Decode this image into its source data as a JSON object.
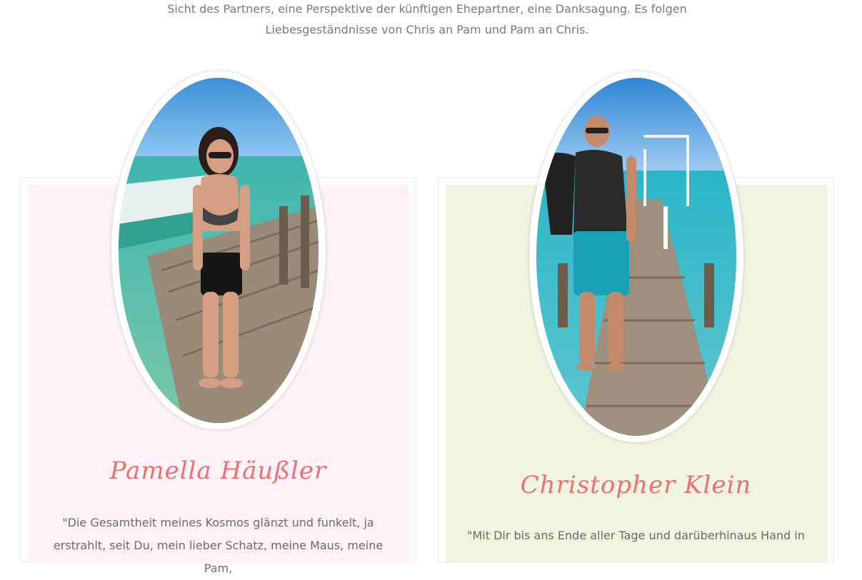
{
  "intro": {
    "line1": "Sicht des Partners, eine Perspektive der künftigen Ehepartner, eine Danksagung. Es folgen",
    "line2": "Liebesgeständnisse von Chris an Pam und Pam an Chris."
  },
  "profiles": [
    {
      "name": "Pamella Häußler",
      "quote": "\"Die Gesamtheit meines Kosmos glänzt und funkelt, ja erstrahlt, seit Du, mein lieber Schatz, meine Maus, meine Pam,",
      "card_color": "#fff2f7",
      "photo_icon": "woman-on-pier-photo"
    },
    {
      "name": "Christopher Klein",
      "quote": "\"Mit Dir bis ans Ende aller Tage und darüberhinaus Hand in",
      "card_color": "#f1f4e0",
      "photo_icon": "man-on-pier-photo"
    }
  ],
  "colors": {
    "name_accent": "#ee6f6f",
    "text": "#6b6b6b"
  }
}
